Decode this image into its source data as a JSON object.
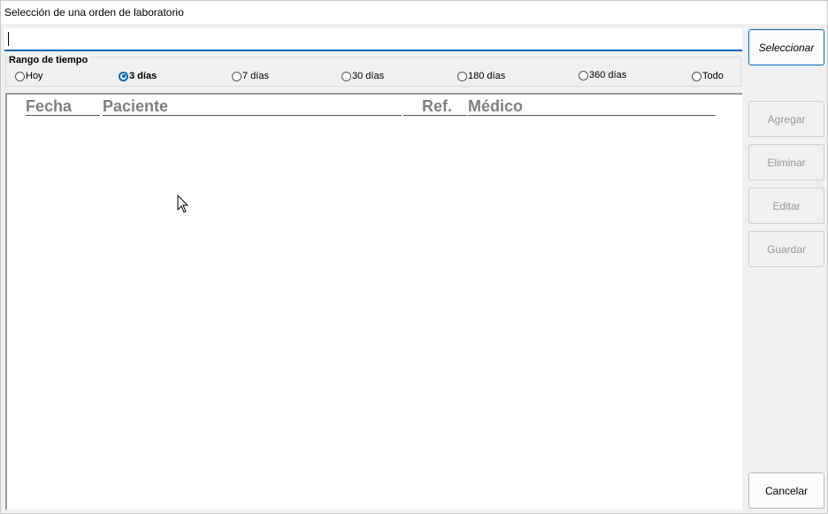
{
  "window": {
    "title": "Selección de una orden de laboratorio"
  },
  "search": {
    "value": "",
    "placeholder": ""
  },
  "buttons": {
    "select": "Seleccionar",
    "add": "Agregar",
    "delete": "Eliminar",
    "edit": "Editar",
    "save": "Guardar",
    "cancel": "Cancelar"
  },
  "range": {
    "label": "Rango de tiempo",
    "selected": "3 días",
    "options": [
      "Hoy",
      "3 días",
      "7 días",
      "30 días",
      "180 días",
      "360 días",
      "Todo"
    ]
  },
  "table": {
    "columns": [
      "Fecha",
      "Paciente",
      "Ref.",
      "Médico"
    ],
    "rows": []
  },
  "colors": {
    "accent": "#0066b4",
    "disabled_text": "#9a9a9a",
    "header_text": "#808080"
  }
}
